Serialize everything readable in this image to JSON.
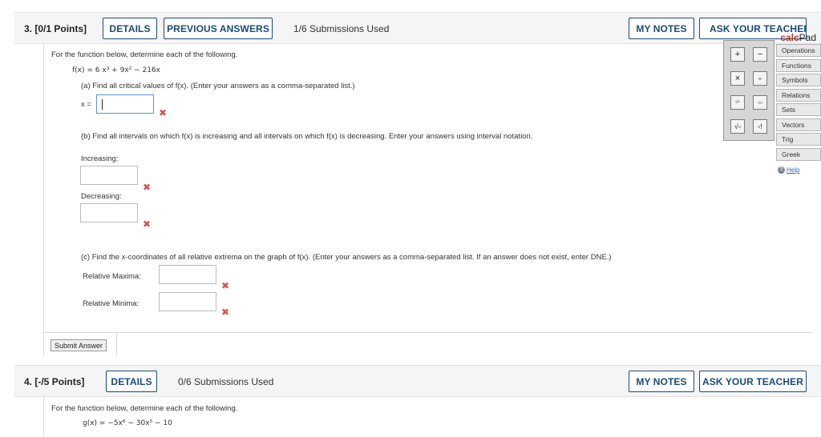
{
  "q3": {
    "number": "3.",
    "points": "[0/1 Points]",
    "details": "DETAILS",
    "previous_answers": "PREVIOUS ANSWERS",
    "submissions": "1/6 Submissions Used",
    "my_notes": "MY NOTES",
    "ask_teacher": "ASK YOUR TEACHER",
    "intro": "For the function below, determine each of the following.",
    "function": "f(x) = 6 x³ + 9x² − 216x",
    "part_a": "(a) Find all critical values of f(x). (Enter your answers as a comma-separated list.)",
    "x_label": "x =",
    "part_b": "(b) Find all intervals on which f(x) is increasing and all intervals on which f(x) is decreasing. Enter your answers using interval notation.",
    "increasing_label": "Increasing:",
    "decreasing_label": "Decreasing:",
    "part_c": "(c) Find the x-coordinates of all relative extrema on the graph of f(x). (Enter your answers as a comma-separated list. If an answer does not exist, enter DNE.)",
    "rel_max_label": "Relative Maxima:",
    "rel_min_label": "Relative Minima:",
    "submit": "Submit Answer",
    "x_mark": "✖"
  },
  "q4": {
    "number": "4.",
    "points": "[-/5 Points]",
    "details": "DETAILS",
    "submissions": "0/6 Submissions Used",
    "my_notes": "MY NOTES",
    "ask_teacher": "ASK YOUR TEACHER",
    "intro": "For the function below, determine each of the following.",
    "function": "g(x) = −5x⁶ − 30x⁵ − 10"
  },
  "calcpad": {
    "title_calc": "calc",
    "title_pad": "Pad",
    "keys": [
      "+",
      "−",
      "×",
      "÷",
      "▫/▫",
      "▫▫",
      "√▫",
      "▫!"
    ],
    "tabs": [
      "Operations",
      "Functions",
      "Symbols",
      "Relations",
      "Sets",
      "Vectors",
      "Trig",
      "Greek"
    ],
    "help": "Help",
    "help_icon_glyph": "?"
  },
  "colors": {
    "accent": "#1a4a7a",
    "error": "#d9534f",
    "calc_red": "#c0392b"
  }
}
